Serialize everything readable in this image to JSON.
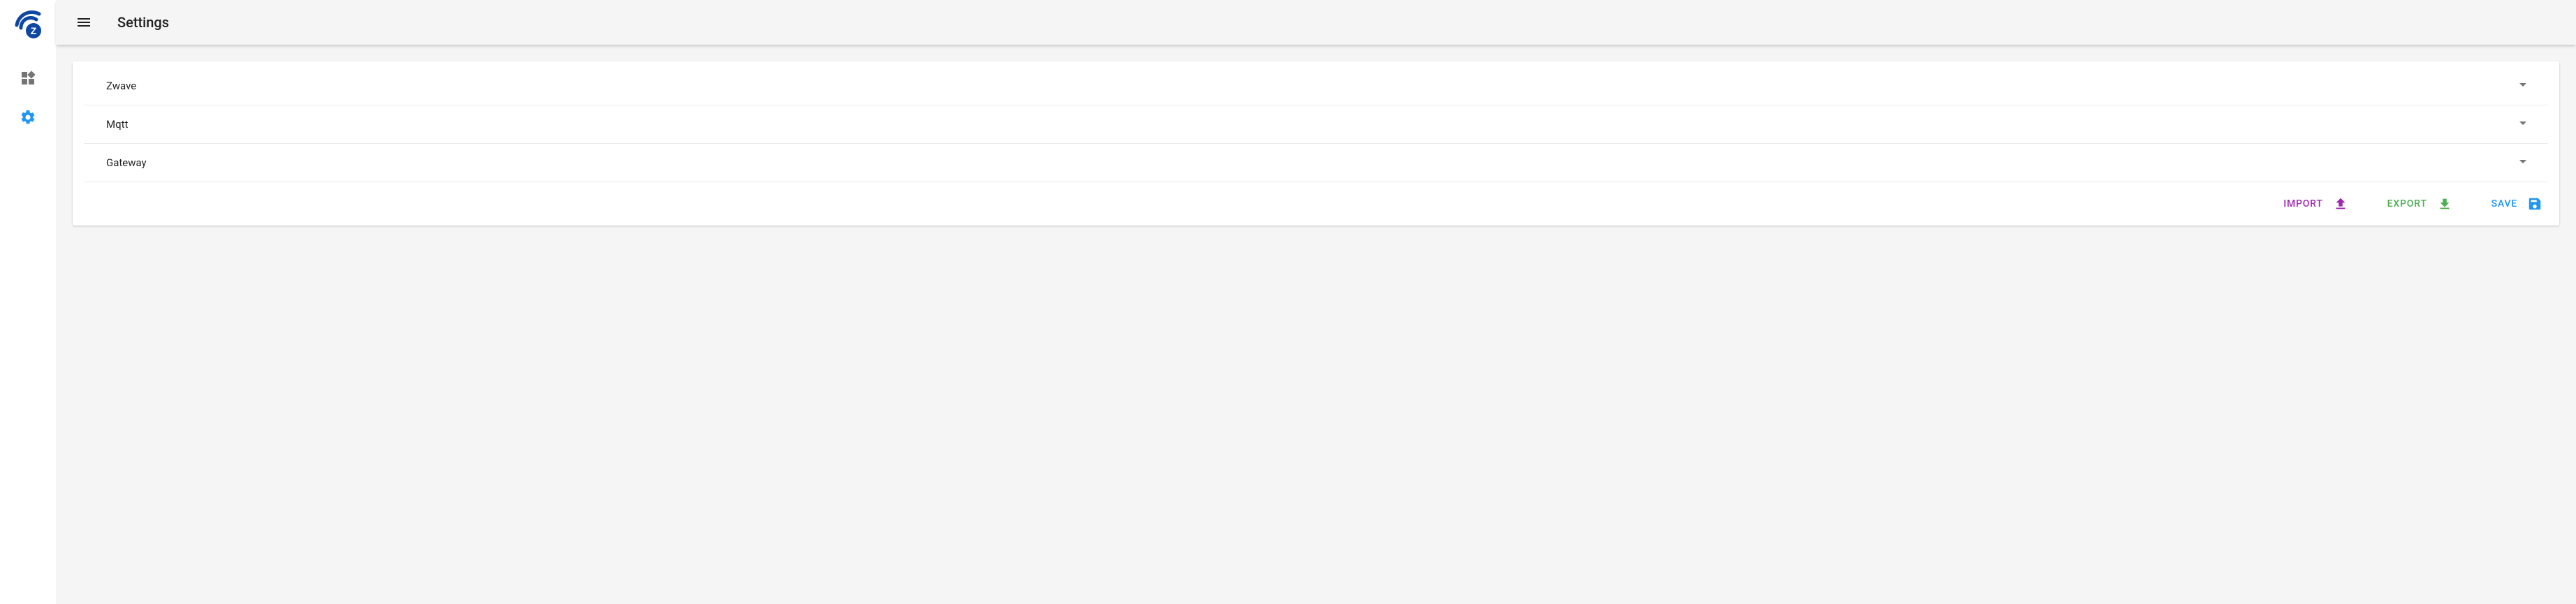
{
  "header": {
    "title": "Settings"
  },
  "sidebar": {
    "logo": "zwave-logo",
    "items": [
      {
        "name": "dashboard",
        "icon": "widgets-icon",
        "active": false
      },
      {
        "name": "settings",
        "icon": "gear-icon",
        "active": true
      }
    ]
  },
  "panels": [
    {
      "label": "Zwave"
    },
    {
      "label": "Mqtt"
    },
    {
      "label": "Gateway"
    }
  ],
  "actions": {
    "import_label": "IMPORT",
    "export_label": "EXPORT",
    "save_label": "SAVE"
  },
  "colors": {
    "brand": "#0D47A1",
    "accent": "#2196F3",
    "import": "#9C27B0",
    "export": "#4CAF50",
    "save": "#2196F3"
  }
}
